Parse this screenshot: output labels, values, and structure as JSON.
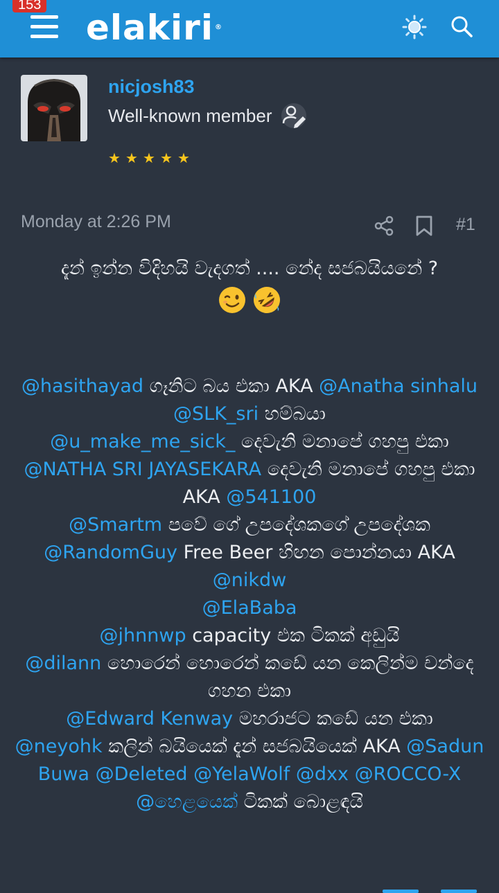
{
  "header": {
    "notification_count": "153",
    "logo_text": "elakiri",
    "logo_mark": "®"
  },
  "post": {
    "username": "nicjosh83",
    "user_title": "Well-known member",
    "rating_stars": 5,
    "date": "Monday at 2:26 PM",
    "post_number": "#1",
    "intro": "දැන් ඉන්න විදිහයි වැදගත් .... නේද සජබයියනේ ?",
    "lines": [
      [
        {
          "t": "m",
          "v": "@hasithayad"
        },
        {
          "t": "x",
          "v": " ගෑනිට බය එකා AKA "
        },
        {
          "t": "m",
          "v": "@Anatha sinhalu"
        }
      ],
      [
        {
          "t": "m",
          "v": "@SLK_sri"
        },
        {
          "t": "x",
          "v": " හම්බයා"
        }
      ],
      [
        {
          "t": "m",
          "v": "@u_make_me_sick_"
        },
        {
          "t": "x",
          "v": " දෙවැනි මනාපේ ගහපු එකා"
        }
      ],
      [
        {
          "t": "m",
          "v": "@NATHA SRI JAYASEKARA"
        },
        {
          "t": "x",
          "v": " දෙවැනි මනාපේ ගහපු එකා AKA "
        },
        {
          "t": "m",
          "v": "@541100"
        }
      ],
      [
        {
          "t": "m",
          "v": "@Smartm"
        },
        {
          "t": "x",
          "v": " පවේ ගේ උපදේශකගේ උපදේශක"
        }
      ],
      [
        {
          "t": "m",
          "v": "@RandomGuy"
        },
        {
          "t": "x",
          "v": " Free Beer හිඟන පොන්නයා AKA "
        },
        {
          "t": "m",
          "v": "@nikdw"
        }
      ],
      [
        {
          "t": "m",
          "v": "@ElaBaba"
        }
      ],
      [
        {
          "t": "m",
          "v": "@jhnnwp"
        },
        {
          "t": "x",
          "v": " capacity එක ටිකක් අඩුයි"
        }
      ],
      [
        {
          "t": "m",
          "v": "@dilann"
        },
        {
          "t": "x",
          "v": " හොරෙන් හොරෙන් කඩේ යන කෙලින්ම චන්දෙ ගහන එකා"
        }
      ],
      [
        {
          "t": "m",
          "v": "@Edward Kenway"
        },
        {
          "t": "x",
          "v": " මහරාජට කඩේ යන එකා"
        }
      ],
      [
        {
          "t": "m",
          "v": "@neyohk"
        },
        {
          "t": "x",
          "v": " කලින් බයියෙක් දැන් සජබයියෙක් AKA "
        },
        {
          "t": "m",
          "v": "@Sadun Buwa"
        },
        {
          "t": "x",
          "v": " "
        },
        {
          "t": "m",
          "v": "@Deleted"
        },
        {
          "t": "x",
          "v": " "
        },
        {
          "t": "m",
          "v": "@YelaWolf"
        },
        {
          "t": "x",
          "v": " "
        },
        {
          "t": "m",
          "v": "@dxx"
        },
        {
          "t": "x",
          "v": " "
        },
        {
          "t": "m",
          "v": "@ROCCO-X"
        }
      ],
      [
        {
          "t": "m",
          "v": "@හෙළයෙක්"
        },
        {
          "t": "x",
          "v": " ටිකක් බොළඳයි"
        }
      ]
    ],
    "emojis": [
      "winking-face-emoji",
      "rolling-on-floor-laughing-emoji"
    ]
  },
  "colors": {
    "header_bg": "#1f8fd6",
    "page_bg": "#2c3440",
    "accent": "#2ea4f0",
    "badge": "#d8312a",
    "star": "#f7c51d"
  }
}
